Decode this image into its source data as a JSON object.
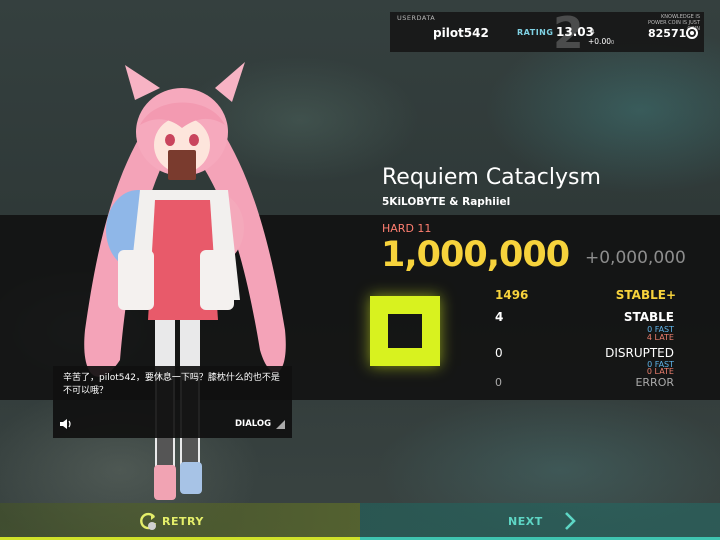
{
  "userdata": {
    "label": "USERDATA",
    "username": "pilot542",
    "rank": "2",
    "rating_label": "RATING",
    "rating_value": "13.03",
    "rating_small": "4",
    "rating_delta": "+0.00",
    "rating_delta_small": "0",
    "motto": "KNOWLEDGE IS POWER COIN IS JUST COIN",
    "coins": "82571",
    "coin_icon": "coin-icon"
  },
  "song": {
    "title": "Requiem Cataclysm",
    "artist": "5KiLOBYTE & Raphiiel",
    "difficulty": "HARD 11"
  },
  "result": {
    "score": "1,000,000",
    "score_delta": "+0,000,000",
    "grade_color": "#d8f21f",
    "max_combo": "1496",
    "clear_type": "STABLE+",
    "stable_count": "4",
    "stable_label": "STABLE",
    "stable_fast": "0 FAST",
    "stable_late": "4 LATE",
    "disrupted_count": "0",
    "disrupted_label": "DISRUPTED",
    "disrupted_fast": "0 FAST",
    "disrupted_late": "0 LATE",
    "error_count": "0",
    "error_label": "ERROR"
  },
  "dialog": {
    "text": "辛苦了，pilot542，要休息一下吗？膝枕什么的也不是不可以哦？",
    "label": "DIALOG",
    "speaker_icon": "speaker-icon",
    "arrow_icon": "corner-arrow-icon"
  },
  "footer": {
    "retry_label": "RETRY",
    "next_label": "NEXT",
    "retry_icon": "retry-icon",
    "next_icon": "chevron-right-icon"
  },
  "colors": {
    "score": "#f7d33c",
    "difficulty": "#ff7e70",
    "fast": "#5fb4ea",
    "late": "#ec7f6e",
    "retry_accent": "#cfe12a",
    "next_accent": "#3fc4b0"
  }
}
